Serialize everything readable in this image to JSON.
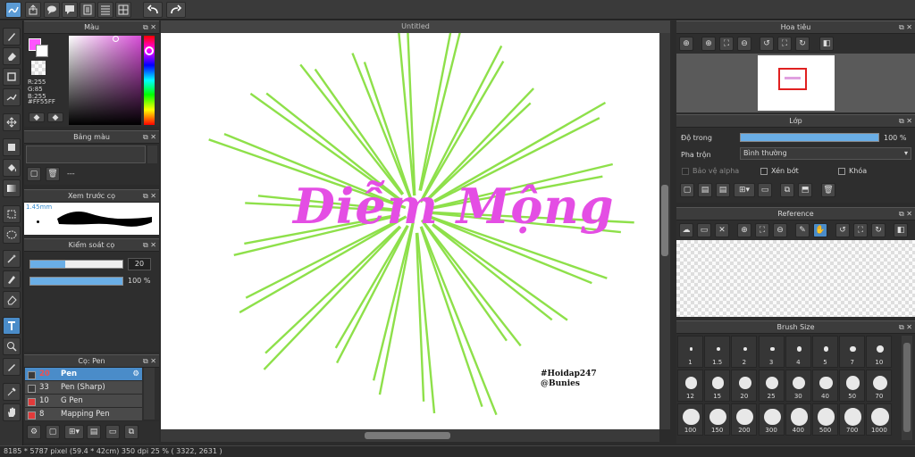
{
  "canvas": {
    "tab_title": "Untitled",
    "artwork_title": "Diễm Mộng",
    "watermark_line1": "#Hoidap247",
    "watermark_line2": "@Bunies"
  },
  "color_panel": {
    "title": "Màu",
    "r": "R:255",
    "g": "G:85",
    "b": "B:255",
    "hex": "#FF55FF",
    "foreground_color": "#FF55FF",
    "hue_color": "#D84ED8"
  },
  "palette_panel": {
    "title": "Bảng màu",
    "placeholder": "---"
  },
  "brush_preview_panel": {
    "title": "Xem trước cọ",
    "size": "1.45mm"
  },
  "brush_control_panel": {
    "title": "Kiểm soát cọ",
    "size_value": "20",
    "size_fraction": 0.38,
    "opacity_value": "100 %",
    "opacity_fraction": 1.0
  },
  "brush_list_panel": {
    "title": "Cọ: Pen",
    "items": [
      {
        "size": "20",
        "name": "Pen",
        "selected": true,
        "color": "#3a3a3a"
      },
      {
        "size": "33",
        "name": "Pen (Sharp)",
        "selected": false,
        "color": "#3a3a3a"
      },
      {
        "size": "10",
        "name": "G Pen",
        "selected": false,
        "color": "#e23a3a"
      },
      {
        "size": "8",
        "name": "Mapping Pen",
        "selected": false,
        "color": "#e23a3a"
      }
    ]
  },
  "navigator_panel": {
    "title": "Hoa tiêu"
  },
  "layer_panel": {
    "title": "Lớp",
    "opacity_label": "Độ trong",
    "opacity_value": "100 %",
    "opacity_fraction": 1.0,
    "blend_label": "Pha trộn",
    "blend_value": "Bình thường",
    "protect_alpha_label": "Bảo vệ alpha",
    "clipping_label": "Xén bớt",
    "lock_label": "Khóa"
  },
  "reference_panel": {
    "title": "Reference"
  },
  "brush_size_panel": {
    "title": "Brush Size",
    "sizes": [
      "1",
      "1.5",
      "2",
      "3",
      "4",
      "5",
      "7",
      "10",
      "12",
      "15",
      "20",
      "25",
      "30",
      "40",
      "50",
      "70",
      "100",
      "150",
      "200",
      "300",
      "400",
      "500",
      "700",
      "1000"
    ]
  },
  "status_bar": {
    "text": "8185 * 5787 pixel   (59.4 * 42cm)   350 dpi   25 %   ( 3322, 2631 )"
  }
}
